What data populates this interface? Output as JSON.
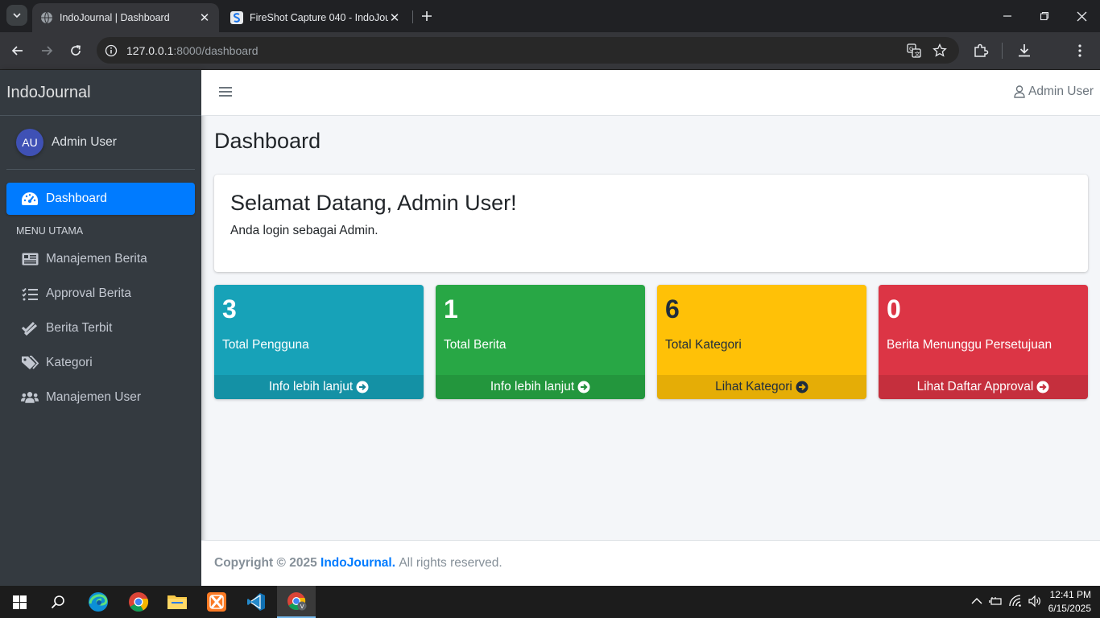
{
  "browser": {
    "tabs": [
      {
        "title": "IndoJournal | Dashboard",
        "active": true
      },
      {
        "title": "FireShot Capture 040 - IndoJou",
        "active": false
      }
    ],
    "url_host": "127.0.0.1",
    "url_path": ":8000/dashboard",
    "profile_initial": "V"
  },
  "sidebar": {
    "brand": "IndoJournal",
    "user_initials": "AU",
    "user_name": "Admin User",
    "items": [
      {
        "label": "Dashboard",
        "icon": "tachometer-icon",
        "active": true
      },
      {
        "label": "Manajemen Berita",
        "icon": "newspaper-icon"
      },
      {
        "label": "Approval Berita",
        "icon": "tasks-icon"
      },
      {
        "label": "Berita Terbit",
        "icon": "check-double-icon"
      },
      {
        "label": "Kategori",
        "icon": "tags-icon"
      },
      {
        "label": "Manajemen User",
        "icon": "users-icon"
      }
    ],
    "section_header": "MENU UTAMA"
  },
  "topnav": {
    "user_label": "Admin User"
  },
  "page": {
    "title": "Dashboard",
    "welcome_title": "Selamat Datang, Admin User!",
    "welcome_text": "Anda login sebagai Admin."
  },
  "stats": [
    {
      "value": "3",
      "label": "Total Pengguna",
      "link": "Info lebih lanjut",
      "color": "#17a2b8"
    },
    {
      "value": "1",
      "label": "Total Berita",
      "link": "Info lebih lanjut",
      "color": "#28a745"
    },
    {
      "value": "6",
      "label": "Total Kategori",
      "link": "Lihat Kategori",
      "color": "#ffc107"
    },
    {
      "value": "0",
      "label": "Berita Menunggu Persetujuan",
      "link": "Lihat Daftar Approval",
      "color": "#dc3545"
    }
  ],
  "footer": {
    "copyright": "Copyright © 2025",
    "brand": "IndoJournal.",
    "rights": "All rights reserved."
  },
  "taskbar": {
    "time": "12:41 PM",
    "date": "6/15/2025"
  }
}
